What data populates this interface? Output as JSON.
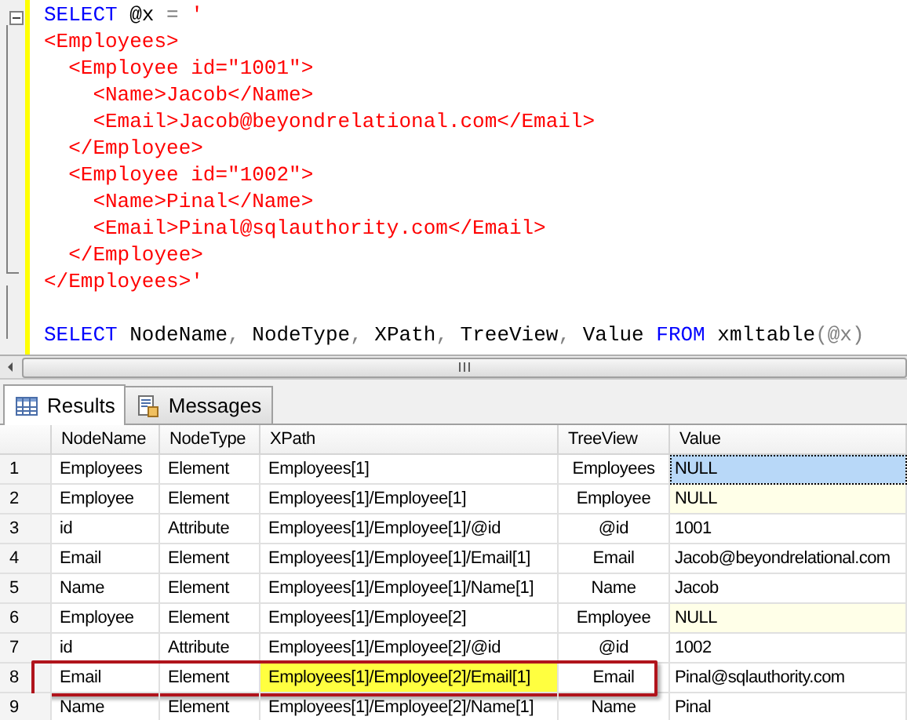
{
  "editor": {
    "lines": [
      {
        "segments": [
          {
            "kind": "keyword",
            "text": "SELECT"
          },
          {
            "kind": "plain",
            "text": " @x "
          },
          {
            "kind": "operator",
            "text": "="
          },
          {
            "kind": "string",
            "text": " '"
          }
        ]
      },
      {
        "segments": [
          {
            "kind": "string",
            "text": "<Employees>"
          }
        ]
      },
      {
        "segments": [
          {
            "kind": "string",
            "text": "  <Employee id=\"1001\">"
          }
        ]
      },
      {
        "segments": [
          {
            "kind": "string",
            "text": "    <Name>Jacob</Name>"
          }
        ]
      },
      {
        "segments": [
          {
            "kind": "string",
            "text": "    <Email>Jacob@beyondrelational.com</Email>"
          }
        ]
      },
      {
        "segments": [
          {
            "kind": "string",
            "text": "  </Employee>"
          }
        ]
      },
      {
        "segments": [
          {
            "kind": "string",
            "text": "  <Employee id=\"1002\">"
          }
        ]
      },
      {
        "segments": [
          {
            "kind": "string",
            "text": "    <Name>Pinal</Name>"
          }
        ]
      },
      {
        "segments": [
          {
            "kind": "string",
            "text": "    <Email>Pinal@sqlauthority.com</Email>"
          }
        ]
      },
      {
        "segments": [
          {
            "kind": "string",
            "text": "  </Employee>"
          }
        ]
      },
      {
        "segments": [
          {
            "kind": "string",
            "text": "</Employees>'"
          }
        ]
      },
      {
        "blank": true
      },
      {
        "segments": [
          {
            "kind": "keyword",
            "text": "SELECT"
          },
          {
            "kind": "plain",
            "text": " NodeName"
          },
          {
            "kind": "operator",
            "text": ","
          },
          {
            "kind": "plain",
            "text": " NodeType"
          },
          {
            "kind": "operator",
            "text": ","
          },
          {
            "kind": "plain",
            "text": " XPath"
          },
          {
            "kind": "operator",
            "text": ","
          },
          {
            "kind": "plain",
            "text": " TreeView"
          },
          {
            "kind": "operator",
            "text": ","
          },
          {
            "kind": "plain",
            "text": " Value "
          },
          {
            "kind": "keyword",
            "text": "FROM"
          },
          {
            "kind": "plain",
            "text": " xmltable"
          },
          {
            "kind": "operator",
            "text": "(@x)"
          }
        ]
      }
    ]
  },
  "tabs": [
    {
      "label": "Results",
      "kind": "grid",
      "selected": true
    },
    {
      "label": "Messages",
      "kind": "document",
      "selected": false
    }
  ],
  "table": {
    "columns": [
      "NodeName",
      "NodeType",
      "XPath",
      "TreeView",
      "Value"
    ],
    "rows": [
      {
        "num": "1",
        "node_name": "Employees",
        "node_type": "Element",
        "xpath": "Employees[1]",
        "tree_view": "Employees",
        "value": "NULL",
        "value_null": true,
        "value_selected": true,
        "outlined": false,
        "xpath_highlighted": false
      },
      {
        "num": "2",
        "node_name": "Employee",
        "node_type": "Element",
        "xpath": "Employees[1]/Employee[1]",
        "tree_view": "Employee",
        "value": "NULL",
        "value_null": true,
        "value_selected": false,
        "outlined": false,
        "xpath_highlighted": false
      },
      {
        "num": "3",
        "node_name": "id",
        "node_type": "Attribute",
        "xpath": "Employees[1]/Employee[1]/@id",
        "tree_view": "@id",
        "value": "1001",
        "value_null": false,
        "value_selected": false,
        "outlined": false,
        "xpath_highlighted": false
      },
      {
        "num": "4",
        "node_name": "Email",
        "node_type": "Element",
        "xpath": "Employees[1]/Employee[1]/Email[1]",
        "tree_view": "Email",
        "value": "Jacob@beyondrelational.com",
        "value_null": false,
        "value_selected": false,
        "outlined": false,
        "xpath_highlighted": false
      },
      {
        "num": "5",
        "node_name": "Name",
        "node_type": "Element",
        "xpath": "Employees[1]/Employee[1]/Name[1]",
        "tree_view": "Name",
        "value": "Jacob",
        "value_null": false,
        "value_selected": false,
        "outlined": false,
        "xpath_highlighted": false
      },
      {
        "num": "6",
        "node_name": "Employee",
        "node_type": "Element",
        "xpath": "Employees[1]/Employee[2]",
        "tree_view": "Employee",
        "value": "NULL",
        "value_null": true,
        "value_selected": false,
        "outlined": false,
        "xpath_highlighted": false
      },
      {
        "num": "7",
        "node_name": "id",
        "node_type": "Attribute",
        "xpath": "Employees[1]/Employee[2]/@id",
        "tree_view": "@id",
        "value": "1002",
        "value_null": false,
        "value_selected": false,
        "outlined": false,
        "xpath_highlighted": false
      },
      {
        "num": "8",
        "node_name": "Email",
        "node_type": "Element",
        "xpath": "Employees[1]/Employee[2]/Email[1]",
        "tree_view": "Email",
        "value": "Pinal@sqlauthority.com",
        "value_null": false,
        "value_selected": false,
        "outlined": true,
        "xpath_highlighted": true
      },
      {
        "num": "9",
        "node_name": "Name",
        "node_type": "Element",
        "xpath": "Employees[1]/Employee[2]/Name[1]",
        "tree_view": "Name",
        "value": "Pinal",
        "value_null": false,
        "value_selected": false,
        "outlined": false,
        "xpath_highlighted": false
      }
    ]
  }
}
